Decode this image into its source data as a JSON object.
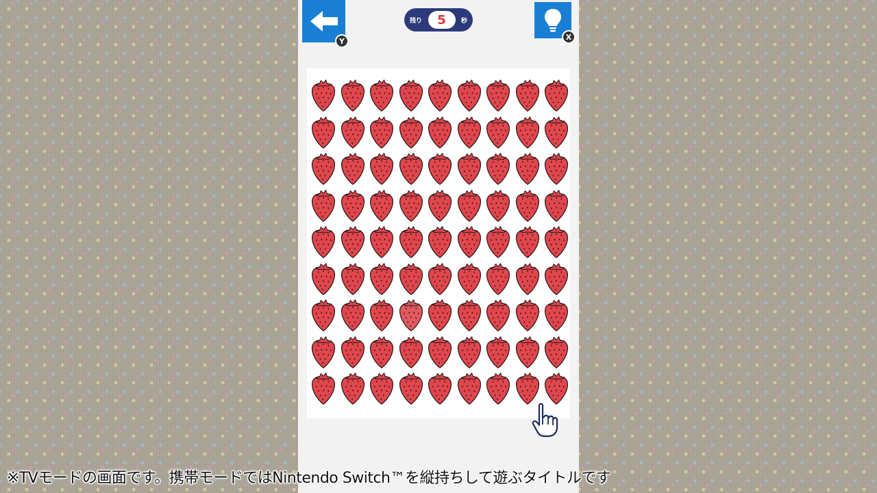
{
  "timer": {
    "label_left": "残り",
    "count": "5",
    "label_right": "秒"
  },
  "buttons": {
    "back": {
      "icon": "arrow-left-icon",
      "badge": "Y"
    },
    "hint": {
      "icon": "lightbulb-icon",
      "badge": "X"
    }
  },
  "puzzle": {
    "rows": 9,
    "cols": 9,
    "item": "strawberry",
    "colors": {
      "normal": "#e0464d",
      "odd": "#e25a5f",
      "outline": "#2a1a1a"
    },
    "odd_cell": {
      "row": 6,
      "col": 3
    }
  },
  "colors": {
    "accent": "#1a7fd4",
    "timer_bg": "#2d3a7a",
    "timer_count": "#e53232"
  },
  "caption": "※TVモードの画面です。携帯モードではNintendo Switch™を縦持ちして遊ぶタイトルです"
}
